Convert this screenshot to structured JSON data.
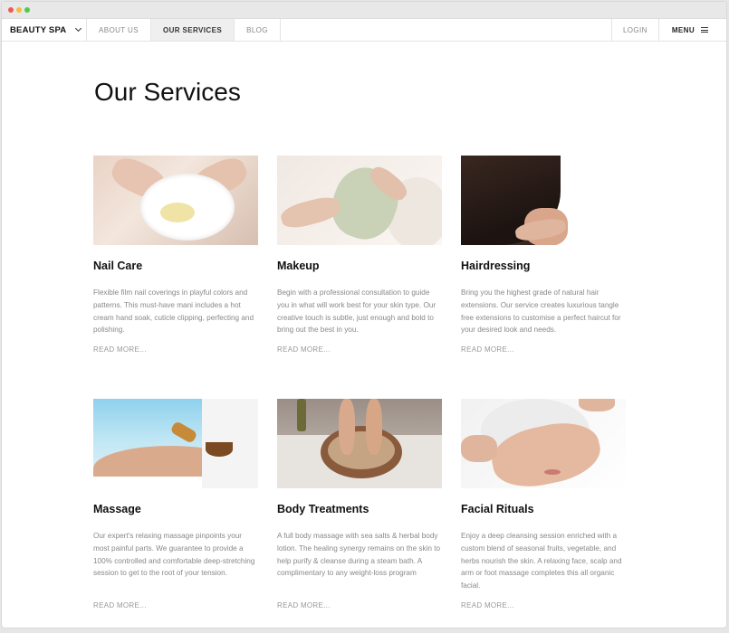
{
  "nav": {
    "brand": "BEAUTY SPA",
    "items": [
      "ABOUT US",
      "OUR SERVICES",
      "BLOG"
    ],
    "login": "LOGIN",
    "menu": "MENU"
  },
  "page": {
    "title": "Our Services"
  },
  "services": [
    {
      "title": "Nail Care",
      "text": "Flexible film nail coverings in playful colors and patterns. This must-have mani includes a hot cream hand soak, cuticle clipping, perfecting and polishing.",
      "link": "READ MORE..."
    },
    {
      "title": "Makeup",
      "text": "Begin with a professional consultation to guide you in what will work best for your skin type. Our creative touch is subtle, just enough and bold to bring out the best in you.",
      "link": "READ MORE..."
    },
    {
      "title": "Hairdressing",
      "text": "Bring you the highest grade of natural hair extensions. Our service creates luxurious tangle free extensions to customise a perfect haircut for your desired look and needs.",
      "link": "READ MORE..."
    },
    {
      "title": "Massage",
      "text": "Our expert's relaxing massage pinpoints your most painful parts. We guarantee to provide a 100% controlled and comfortable deep-stretching session to get to the root of your tension.",
      "link": "READ MORE..."
    },
    {
      "title": "Body Treatments",
      "text": "A full body massage with sea salts & herbal body lotion. The healing synergy remains on the skin to help purify & cleanse during a steam bath. A complimentary to any weight-loss program",
      "link": "READ MORE..."
    },
    {
      "title": "Facial Rituals",
      "text": "Enjoy a deep cleansing session enriched with a custom blend of seasonal fruits, vegetable, and herbs nourish the skin. A relaxing face, scalp and arm or foot massage completes this all organic facial.",
      "link": "READ MORE..."
    }
  ]
}
